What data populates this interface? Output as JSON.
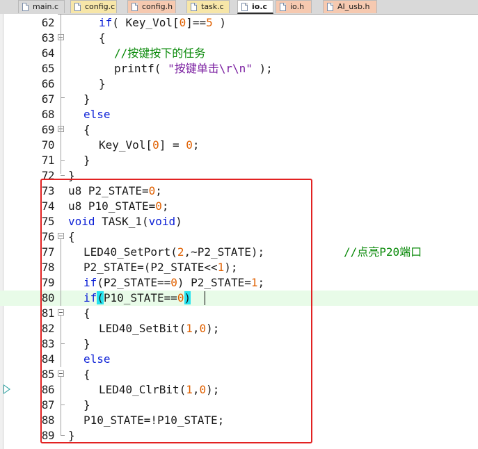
{
  "tabs": [
    {
      "label": "main.c",
      "color": "#d9d9d9"
    },
    {
      "label": "config.c",
      "color": "#f7e6a8"
    },
    {
      "label": "config.h",
      "color": "#f6c9b0"
    },
    {
      "label": "task.c",
      "color": "#f7e6a8"
    },
    {
      "label": "io.c",
      "color": "#ffffff"
    },
    {
      "label": "io.h",
      "color": "#f6c9b0"
    },
    {
      "label": "AI_usb.h",
      "color": "#f6c9b0"
    }
  ],
  "active_tab": "io.c",
  "lines": [
    {
      "n": "62"
    },
    {
      "n": "63"
    },
    {
      "n": "64"
    },
    {
      "n": "65"
    },
    {
      "n": "66"
    },
    {
      "n": "67"
    },
    {
      "n": "68"
    },
    {
      "n": "69"
    },
    {
      "n": "70"
    },
    {
      "n": "71"
    },
    {
      "n": "72"
    },
    {
      "n": "73"
    },
    {
      "n": "74"
    },
    {
      "n": "75"
    },
    {
      "n": "76"
    },
    {
      "n": "77"
    },
    {
      "n": "78"
    },
    {
      "n": "79"
    },
    {
      "n": "80"
    },
    {
      "n": "81"
    },
    {
      "n": "82"
    },
    {
      "n": "83"
    },
    {
      "n": "84"
    },
    {
      "n": "85"
    },
    {
      "n": "86"
    },
    {
      "n": "87"
    },
    {
      "n": "88"
    },
    {
      "n": "89"
    }
  ],
  "code": {
    "l62": {
      "kw": "if",
      "rest": "( Key_Vol[",
      "n0": "0",
      "rest2": "]==",
      "n1": "5",
      "rest3": " )"
    },
    "l63": "{",
    "l64": "//按键按下的任务",
    "l65": {
      "pre": "printf( ",
      "str": "\"按键单击\\r\\n\"",
      "post": " );"
    },
    "l66": "}",
    "l67": "}",
    "l68": "else",
    "l69": "{",
    "l70": {
      "pre": "Key_Vol[",
      "n0": "0",
      "mid": "] = ",
      "n1": "0",
      "post": ";"
    },
    "l71": "}",
    "l72": "}",
    "l73": {
      "pre": "u8 P2_STATE=",
      "n0": "0",
      "post": ";"
    },
    "l74": {
      "pre": "u8 P10_STATE=",
      "n0": "0",
      "post": ";"
    },
    "l75": {
      "kw": "void",
      "mid": " TASK_1(",
      "kw2": "void",
      "post": ")"
    },
    "l76": "{",
    "l77": {
      "pre": "LED40_SetPort(",
      "n0": "2",
      "post": ",~P2_STATE);",
      "comment": "//点亮P20端口"
    },
    "l78": {
      "pre": "P2_STATE=(P2_STATE<<",
      "n0": "1",
      "post": ");"
    },
    "l79": {
      "kw": "if",
      "pre": "(P2_STATE==",
      "n0": "0",
      "mid": ") P2_STATE=",
      "n1": "1",
      "post": ";"
    },
    "l80": {
      "kw": "if",
      "open": "(",
      "pre": "P10_STATE==",
      "n0": "0",
      "close": ")"
    },
    "l81": "{",
    "l82": {
      "pre": "LED40_SetBit(",
      "n0": "1",
      "mid": ",",
      "n1": "0",
      "post": ");"
    },
    "l83": "}",
    "l84": "else",
    "l85": "{",
    "l86": {
      "pre": "LED40_ClrBit(",
      "n0": "1",
      "mid": ",",
      "n1": "0",
      "post": ");"
    },
    "l87": "}",
    "l88": "P10_STATE=!P10_STATE;",
    "l89": "}"
  },
  "colors": {
    "keyword": "#0a1ed6",
    "number": "#e06000",
    "comment": "#0a8a0a",
    "string": "#7a1ea0",
    "annotation_box": "#e22222",
    "current_line": "#e8fbe8",
    "bracket_match": "#24e3ef"
  }
}
